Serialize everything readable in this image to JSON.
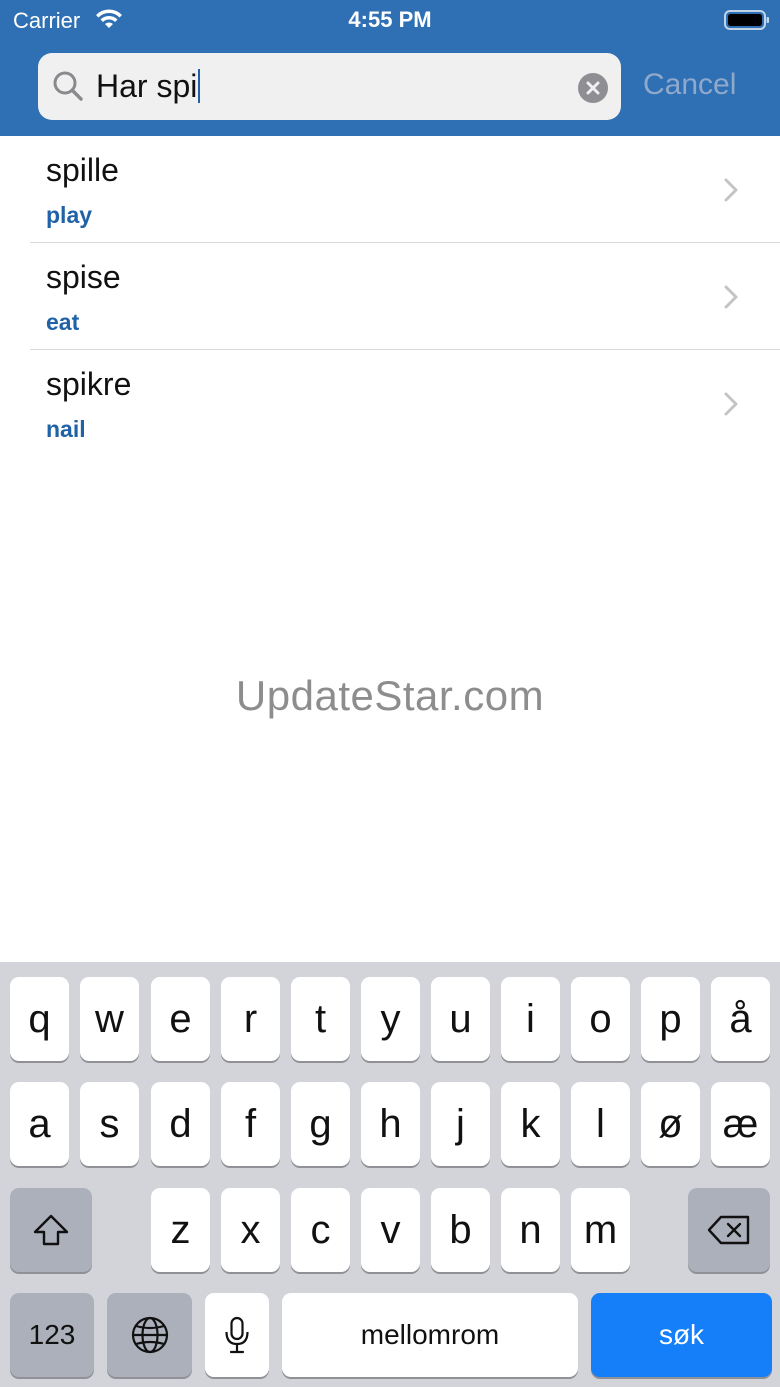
{
  "status": {
    "carrier": "Carrier",
    "time": "4:55 PM"
  },
  "search": {
    "query": "Har spi",
    "cancel_label": "Cancel"
  },
  "results": [
    {
      "word": "spille",
      "translation": "play"
    },
    {
      "word": "spise",
      "translation": "eat"
    },
    {
      "word": "spikre",
      "translation": "nail"
    }
  ],
  "watermark": "UpdateStar.com",
  "keyboard": {
    "row1": [
      "q",
      "w",
      "e",
      "r",
      "t",
      "y",
      "u",
      "i",
      "o",
      "p",
      "å"
    ],
    "row2": [
      "a",
      "s",
      "d",
      "f",
      "g",
      "h",
      "j",
      "k",
      "l",
      "ø",
      "æ"
    ],
    "row3": [
      "z",
      "x",
      "c",
      "v",
      "b",
      "n",
      "m"
    ],
    "numbers_label": "123",
    "space_label": "mellomrom",
    "return_label": "søk"
  },
  "colors": {
    "header": "#2f6fb3",
    "accent": "#157ef9",
    "translation": "#1f63a6"
  }
}
